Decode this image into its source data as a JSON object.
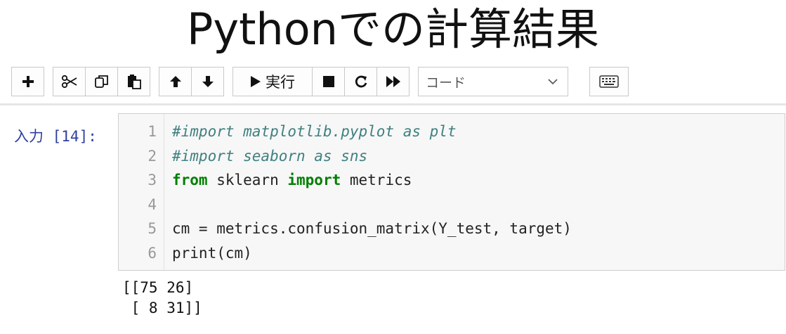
{
  "slide": {
    "title": "Pythonでの計算結果"
  },
  "toolbar": {
    "icons": [
      "plus-icon",
      "scissors-icon",
      "copy-icon",
      "paste-icon",
      "arrow-up-icon",
      "arrow-down-icon",
      "play-icon",
      "stop-icon",
      "restart-icon",
      "fast-forward-icon",
      "keyboard-icon"
    ],
    "run_label": "実行",
    "cell_type": "コード"
  },
  "cell": {
    "prompt": "入力 [14]:",
    "lines": [
      {
        "num": "1",
        "comment": "#import matplotlib.pyplot as plt"
      },
      {
        "num": "2",
        "comment": "#import seaborn as sns"
      },
      {
        "num": "3",
        "kw1": "from",
        "mid": " sklearn ",
        "kw2": "import",
        "rest": " metrics"
      },
      {
        "num": "4",
        "text": ""
      },
      {
        "num": "5",
        "text": "cm = metrics.confusion_matrix(Y_test, target)"
      },
      {
        "num": "6",
        "text": "print(cm)"
      }
    ]
  },
  "output": {
    "line1": "[[75 26]",
    "line2": " [ 8 31]]"
  },
  "colors": {
    "prompt": "#303f9f",
    "comment": "#408080",
    "keyword": "#008000"
  }
}
